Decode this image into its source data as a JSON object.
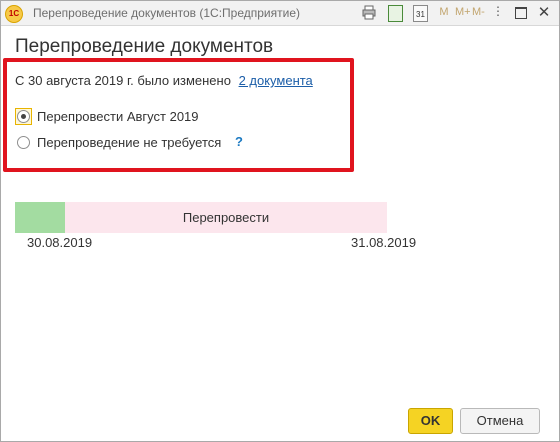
{
  "window": {
    "title": "Перепроведение документов  (1С:Предприятие)",
    "app_logo_text": "1С",
    "toolbar": {
      "calendar_day": "31",
      "m_buttons": [
        "M",
        "M+",
        "M-"
      ],
      "more": "⋮",
      "close": "✕"
    }
  },
  "form": {
    "heading": "Перепроведение документов",
    "info_text": "С 30 августа 2019 г. было изменено",
    "docs_link": "2 документа",
    "options": [
      {
        "label": "Перепровести Август 2019",
        "checked": true
      },
      {
        "label": "Перепроведение не требуется",
        "checked": false
      }
    ],
    "help": "?"
  },
  "timeline": {
    "label": "Перепровести",
    "start_date": "30.08.2019",
    "end_date": "31.08.2019",
    "colors": {
      "done": "#a3dca1",
      "pending": "#fce6ed"
    }
  },
  "buttons": {
    "ok": "OK",
    "cancel": "Отмена"
  },
  "colors": {
    "highlight_border": "#e0141e",
    "ok_button": "#f5d323",
    "link": "#1c5ea8"
  }
}
